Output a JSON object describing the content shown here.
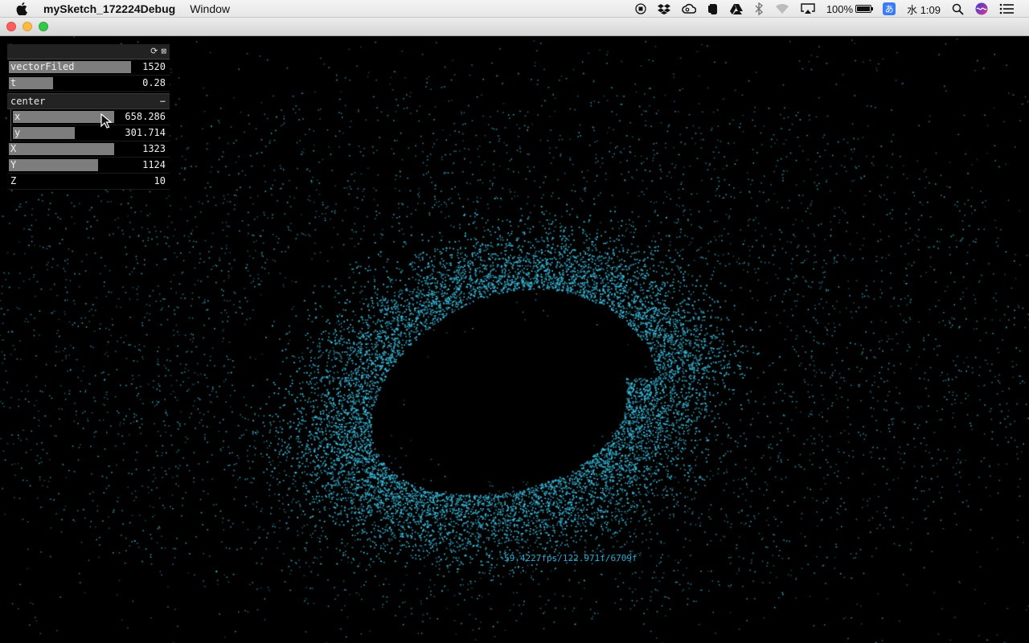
{
  "menubar": {
    "app_name": "mySketch_172224Debug",
    "menu_items": [
      "Window"
    ],
    "battery_text": "100%",
    "battery_level": 1.0,
    "ime_label": "あ",
    "clock": "水 1:09"
  },
  "colors": {
    "particle": "#3ec3e6",
    "fps_text": "#2fa9cf",
    "slider_fill": "#7d7d7d"
  },
  "gui": {
    "rows": [
      {
        "label": "vectorFiled",
        "value": "1520",
        "fill": 0.75
      },
      {
        "label": "t",
        "value": "0.28",
        "fill": 0.27
      }
    ],
    "group": {
      "label": "center",
      "collapse_symbol": "−",
      "rows": [
        {
          "label": "x",
          "value": "658.286",
          "fill": 0.64
        },
        {
          "label": "y",
          "value": "301.714",
          "fill": 0.39
        }
      ]
    },
    "tail_rows": [
      {
        "label": "X",
        "value": "1323",
        "fill": 0.65
      },
      {
        "label": "Y",
        "value": "1124",
        "fill": 0.55
      },
      {
        "label": "Z",
        "value": "10",
        "fill": 0.0
      }
    ]
  },
  "fps_readout": "59.4227fps/122.971f/6709f",
  "icons": [
    "apple-icon",
    "record-icon",
    "dropbox-icon",
    "creative-cloud-icon",
    "evernote-icon",
    "drive-icon",
    "bluetooth-icon",
    "wifi-icon",
    "airplay-icon",
    "battery-icon",
    "search-icon",
    "siri-icon",
    "list-icon",
    "refresh-icon",
    "save-icon",
    "cursor-icon"
  ]
}
